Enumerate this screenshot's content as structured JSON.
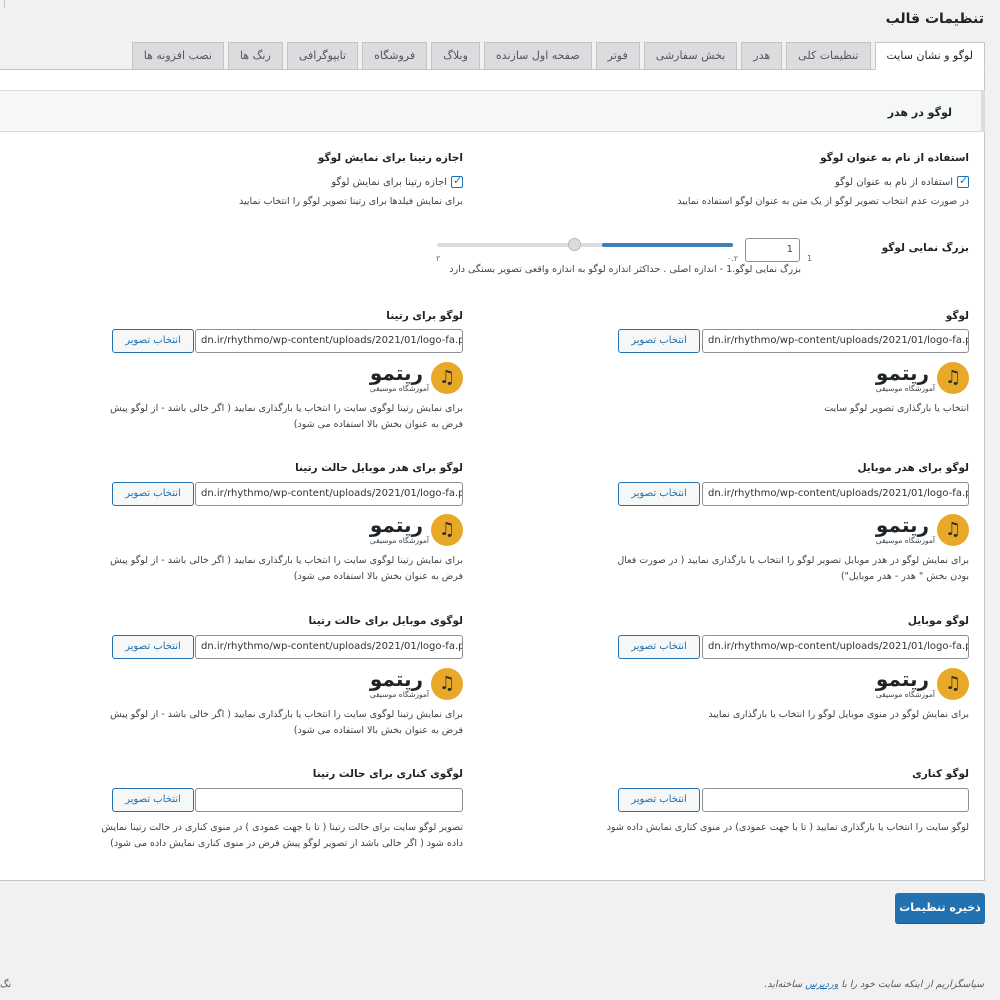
{
  "page_title": "تنظیمات قالب",
  "tabs": [
    {
      "label": "لوگو و نشان سایت",
      "active": true
    },
    {
      "label": "تنظیمات کلی"
    },
    {
      "label": "هدر"
    },
    {
      "label": "بخش سفارشی"
    },
    {
      "label": "فوتر"
    },
    {
      "label": "صفحه اول سازنده"
    },
    {
      "label": "وبلاگ"
    },
    {
      "label": "فروشگاه"
    },
    {
      "label": "تایپوگرافی"
    },
    {
      "label": "رنگ ها"
    },
    {
      "label": "نصب افزونه ها"
    }
  ],
  "section_title": "لوگو در هدر",
  "use_site_name": {
    "title": "استفاده از نام به عنوان لوگو",
    "checkbox_label": "استفاده از نام به عنوان لوگو",
    "checked": true,
    "description": "در صورت عدم انتخاب تصویر لوگو از یک متن به عنوان لوگو استفاده نمایید"
  },
  "allow_retina": {
    "title": "اجازه رتینا برای نمایش لوگو",
    "checkbox_label": "اجازه رتینا برای نمایش لوگو",
    "checked": true,
    "description": "برای نمایش فیلدها برای رتینا تصویر لوگو را انتخاب نمایید"
  },
  "logo_scale": {
    "title": "بزرگ نمایی لوگو",
    "value": "1",
    "description": "بزرگ نمایی لوگو.1 - اندازه اصلی . حداکثر اندازه لوگو به اندازه واقعی تصویر بستگی دارد",
    "tick_left": "۲",
    "tick_mid": "۰.۲",
    "tick_right": "1"
  },
  "select_image_label": "انتخاب تصویر",
  "brand": {
    "name": "ریتمو",
    "tagline": "آموزشگاه موسیقی"
  },
  "fields": {
    "logo": {
      "title": "لوگو",
      "value": "dn.ir/rhythmo/wp-content/uploads/2021/01/logo-fa.png",
      "description": "انتخاب یا بارگذاری تصویر لوگو سایت"
    },
    "logo_retina": {
      "title": "لوگو برای رتینا",
      "value": "dn.ir/rhythmo/wp-content/uploads/2021/01/logo-fa.png",
      "description": "برای نمایش رتینا لوگوی سایت را انتخاب یا بارگذاری نمایید ( اگر خالی باشد - از لوگو پیش فرض به عنوان بخش بالا استفاده می شود)"
    },
    "mobile_header_logo": {
      "title": "لوگو برای هدر موبایل",
      "value": "dn.ir/rhythmo/wp-content/uploads/2021/01/logo-fa.png",
      "description": "برای نمایش لوگو در هدر موبایل تصویر لوگو را انتخاب یا بارگذاری نمایید ( در صورت فعال بودن بخش \" هدر - هدر موبایل\")"
    },
    "mobile_header_logo_retina": {
      "title": "لوگو برای هدر موبایل حالت رتینا",
      "value": "dn.ir/rhythmo/wp-content/uploads/2021/01/logo-fa.png",
      "description": "برای نمایش رتینا لوگوی سایت را انتخاب یا بارگذاری نمایید ( اگر خالی باشد - از لوگو پیش فرض به عنوان بخش بالا استفاده می شود)"
    },
    "mobile_logo": {
      "title": "لوگو موبایل",
      "value": "dn.ir/rhythmo/wp-content/uploads/2021/01/logo-fa.png",
      "description": "برای نمایش لوگو در منوی موبایل لوگو را انتخاب یا بارگذاری نمایید"
    },
    "mobile_logo_retina": {
      "title": "لوگوی موبایل برای حالت رتینا",
      "value": "dn.ir/rhythmo/wp-content/uploads/2021/01/logo-fa.png",
      "description": "برای نمایش رتینا لوگوی سایت را انتخاب یا بارگذاری نمایید ( اگر خالی باشد - از لوگو پیش فرض به عنوان بخش بالا استفاده می شود)"
    },
    "side_logo": {
      "title": "لوگو کناری",
      "value": "",
      "description": "لوگو سایت را انتخاب یا بارگذاری نمایید ( تا با جهت عمودی) در منوی کناری نمایش داده شود"
    },
    "side_logo_retina": {
      "title": "لوگوی کناری برای حالت رتینا",
      "value": "",
      "description": "تصویر لوگو سایت برای حالت رتینا ( تا با جهت عمودی ) در منوی کناری در حالت رتینا نمایش داده شود ( اگر خالی باشد از تصویر لوگو پیش فرض در منوی کناری نمایش داده می شود)"
    }
  },
  "save_button": "ذخیره تنظیمات",
  "footer": {
    "text_before": "سپاسگزاریم از اینکه سایت خود را با ",
    "link": "وردپرس",
    "text_after": " ساخته‌اید.",
    "left_fragment": "نگ"
  },
  "colors": {
    "primary": "#2271b1",
    "logo_accent": "#e9a928",
    "background": "#f1f1f1"
  }
}
